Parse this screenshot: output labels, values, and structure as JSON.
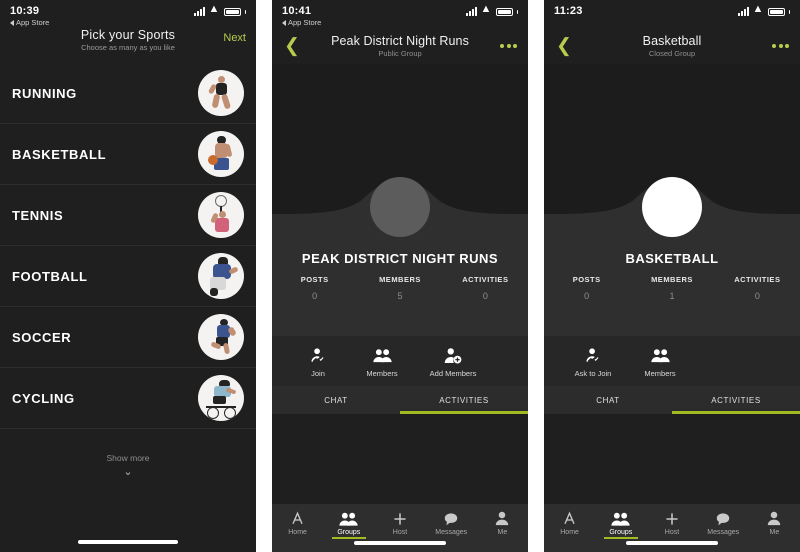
{
  "theme": {
    "accent": "#b9cb4e",
    "tab_underline": "#9fbb20",
    "bg": "#1e1f1e",
    "card": "#2e2f2e"
  },
  "panels": {
    "pick_sports": {
      "status": {
        "time": "10:39",
        "back_app": "App Store",
        "signal": "signal-bars",
        "wifi": "wifi-icon",
        "battery": "battery-icon"
      },
      "header": {
        "title": "Pick your Sports",
        "subtitle": "Choose as many as you like",
        "next": "Next"
      },
      "sports": [
        {
          "name": "RUNNING",
          "avatar": "runner-photo"
        },
        {
          "name": "BASKETBALL",
          "avatar": "basketball-player-photo"
        },
        {
          "name": "TENNIS",
          "avatar": "tennis-player-photo"
        },
        {
          "name": "FOOTBALL",
          "avatar": "football-player-photo"
        },
        {
          "name": "SOCCER",
          "avatar": "soccer-player-photo"
        },
        {
          "name": "CYCLING",
          "avatar": "cyclist-photo"
        }
      ],
      "show_more": {
        "label": "Show more",
        "chevron": "chevron-down-icon"
      }
    },
    "public_group": {
      "status": {
        "time": "10:41",
        "back_app": "App Store"
      },
      "header": {
        "back": "chevron-left-icon",
        "title": "Peak District Night Runs",
        "subtitle": "Public Group",
        "menu": "more-options-icon"
      },
      "group_name": "PEAK DISTRICT NIGHT RUNS",
      "avatar": "group-avatar-grey",
      "stats": [
        {
          "key": "POSTS",
          "value": "0"
        },
        {
          "key": "MEMBERS",
          "value": "5"
        },
        {
          "key": "ACTIVITIES",
          "value": "0"
        }
      ],
      "actions": [
        {
          "label": "Join",
          "icon": "user-check-icon"
        },
        {
          "label": "Members",
          "icon": "users-icon"
        },
        {
          "label": "Add Members",
          "icon": "user-plus-icon"
        }
      ],
      "tabs": [
        {
          "label": "CHAT",
          "active": false
        },
        {
          "label": "ACTIVITIES",
          "active": true
        }
      ],
      "nav": [
        {
          "label": "Home",
          "icon": "home-a-icon",
          "active": false
        },
        {
          "label": "Groups",
          "icon": "groups-icon",
          "active": true
        },
        {
          "label": "Host",
          "icon": "plus-icon",
          "active": false
        },
        {
          "label": "Messages",
          "icon": "chat-bubble-icon",
          "active": false
        },
        {
          "label": "Me",
          "icon": "person-icon",
          "active": false
        }
      ]
    },
    "closed_group": {
      "status": {
        "time": "11:23",
        "back_app": ""
      },
      "header": {
        "back": "chevron-left-icon",
        "title": "Basketball",
        "subtitle": "Closed Group",
        "menu": "more-options-icon"
      },
      "group_name": "BASKETBALL",
      "avatar": "group-avatar-white",
      "stats": [
        {
          "key": "POSTS",
          "value": "0"
        },
        {
          "key": "MEMBERS",
          "value": "1"
        },
        {
          "key": "ACTIVITIES",
          "value": "0"
        }
      ],
      "actions": [
        {
          "label": "Ask to Join",
          "icon": "user-check-icon"
        },
        {
          "label": "Members",
          "icon": "users-icon"
        }
      ],
      "tabs": [
        {
          "label": "CHAT",
          "active": false
        },
        {
          "label": "ACTIVITIES",
          "active": true
        }
      ],
      "nav": [
        {
          "label": "Home",
          "icon": "home-a-icon",
          "active": false
        },
        {
          "label": "Groups",
          "icon": "groups-icon",
          "active": true
        },
        {
          "label": "Host",
          "icon": "plus-icon",
          "active": false
        },
        {
          "label": "Messages",
          "icon": "chat-bubble-icon",
          "active": false
        },
        {
          "label": "Me",
          "icon": "person-icon",
          "active": false
        }
      ]
    }
  }
}
